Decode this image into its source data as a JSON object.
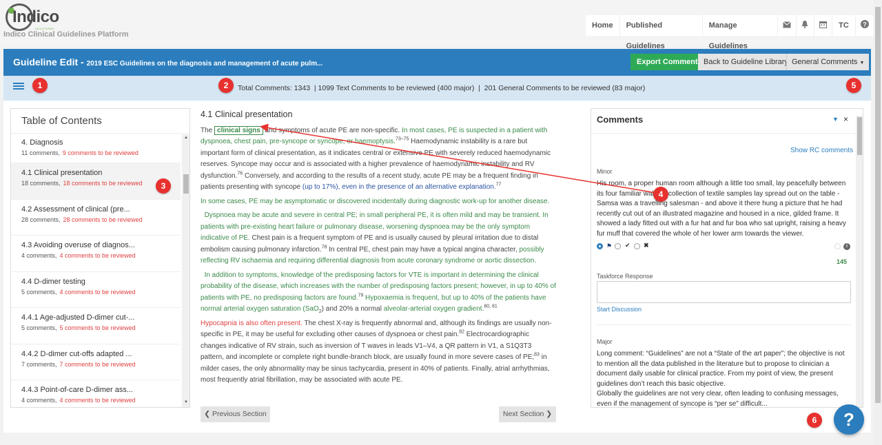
{
  "header": {
    "logo_text": "Indico",
    "logo_sub": "SOLUTIONS",
    "platform_name": "Indico Clinical Guidelines Platform",
    "nav": [
      "Home",
      "Published Guidelines",
      "Manage Guidelines"
    ],
    "icons": [
      "envelope-icon",
      "bell-icon",
      "calendar-icon",
      "user-initials",
      "help-circle-icon"
    ],
    "user_initials": "TC"
  },
  "titlebar": {
    "title": "Guideline Edit - ",
    "subtitle": "2019 ESC Guidelines on the diagnosis and management of acute pulm...",
    "export_label": "Export Comments",
    "back_label": "Back to Guideline Library",
    "general_label": "General Comments"
  },
  "statusbar": {
    "text": "Total Comments: 1343  | 1099 Text Comments to be reviewed (400 major)  |  201 General Comments to be reviewed (83 major)"
  },
  "badges": [
    "1",
    "2",
    "3",
    "4",
    "5",
    "6"
  ],
  "toc": {
    "heading": "Table of Contents",
    "items": [
      {
        "title": "4. Diagnosis",
        "comments": "11 comments,",
        "review": "9 comments to be reviewed"
      },
      {
        "title": "4.1 Clinical presentation",
        "comments": "18 comments,",
        "review": "18 comments to be reviewed"
      },
      {
        "title": "4.2 Assessment of clinical (pre...",
        "comments": "28 comments,",
        "review": "28 comments to be reviewed"
      },
      {
        "title": "4.3 Avoiding overuse of diagnos...",
        "comments": "4 comments,",
        "review": "4 comments to be reviewed"
      },
      {
        "title": "4.4 D-dimer testing",
        "comments": "5 comments,",
        "review": "4 comments to be reviewed"
      },
      {
        "title": "4.4.1 Age-adjusted D-dimer cut-...",
        "comments": "5 comments,",
        "review": "5 comments to be reviewed"
      },
      {
        "title": "4.4.2 D-dimer cut-offs adapted ...",
        "comments": "7 comments,",
        "review": "7 comments to be reviewed"
      },
      {
        "title": "4.4.3 Point-of-care D-dimer ass...",
        "comments": "4 comments,",
        "review": "4 comments to be reviewed"
      }
    ]
  },
  "content": {
    "heading": "4.1 Clinical presentation",
    "p1": {
      "a": "The ",
      "highlight": "clinical signs",
      "b": " and symptoms of acute PE are non-specific. ",
      "c": "In most cases, PE is suspected in a patient with dyspnoea, chest pain, pre-syncope or syncope, or haemoptysis.",
      "sup1": "73–75",
      "d": " Haemodynamic instability is a rare but important form of clinical presentation, as it indicates central or extensive PE with severely reduced haemodynamic reserves. Syncope may occur and is associated with a higher prevalence of haemodynamic instability and RV dysfunction.",
      "sup2": "76",
      "e": " Conversely, and according to the results of a recent study, acute PE may be a frequent finding in patients presenting with syncope ",
      "f": "(up to 17%), even in the presence of an alternative explanation.",
      "sup3": "77"
    },
    "p2": "In some cases, PE may be asymptomatic or discovered incidentally during diagnostic work-up for another disease.",
    "p3": {
      "a": "Dyspnoea may be acute and severe in central PE; in small peripheral PE, it is often mild and may be transient. In patients with pre-existing heart failure or pulmonary disease, worsening dyspnoea may be the only symptom indicative of PE.",
      "b": " Chest pain is a frequent symptom of PE and is usually caused by pleural irritation due to distal embolism causing pulmonary infarction.",
      "sup1": "78",
      "c": " In central PE, chest pain may have a typical angina character, ",
      "d": "possibly reflecting RV ischaemia and requiring differential diagnosis from acute coronary syndrome or aortic dissection."
    },
    "p4": {
      "a": "In addition to symptoms, knowledge of the predisposing factors for VTE is important in determining the clinical probability of the disease, which increases with the number of predisposing factors present; however, in up to 40% of patients with PE, no predisposing factors are found.",
      "sup1": "79",
      "b": " Hypoxaemia is frequent, but up to 40% of the patients have normal arterial oxygen saturation (SaO",
      "b_sub": "2",
      "b2": ") and 20% a normal ",
      "b3": "alveolar-arterial oxygen gradient.",
      "sup2": "80, 81",
      "c": "Hypocapnia is also often present.",
      "d": " The chest X-ray is frequently abnormal and, although its findings are usually non-specific in PE, it may be useful for excluding other causes of dyspnoea or chest pain.",
      "sup3": "82",
      "e": " Electrocardiographic changes indicative of RV strain, such as inversion of T waves in leads V1–V4, a QR pattern in V1, a S1Q3T3 pattern, and incomplete or complete right bundle-branch block, are usually found in more severe cases of PE;",
      "sup4": "83",
      "f": " in milder cases, the only abnormality may be sinus tachycardia, present in 40% of patients. Finally, atrial arrhythmias, most frequently atrial fibrillation, may be associated with acute PE."
    },
    "prev_label": "Previous Section",
    "next_label": "Next Section"
  },
  "comments": {
    "heading": "Comments",
    "show_rc": "Show RC comments",
    "c1": {
      "severity": "Minor",
      "text": "His room, a proper human room although a little too small, lay peacefully between its four familiar walls. A collection of textile samples lay spread out on the table - Samsa was a travelling salesman - and above it there hung a picture that he had recently cut out of an illustrated magazine and housed in a nice, gilded frame. It showed a lady fitted out with a fur hat and fur boa who sat upright, raising a heavy fur muff that covered the whole of her lower arm towards the viewer.",
      "count": "145"
    },
    "taskforce_label": "Taskforce Response",
    "start_discussion": "Start Discussion",
    "c2": {
      "severity": "Major",
      "text1": "Long comment: “Guidelines” are not a “State of the art paper”; the objective is not to mention all the data published in the literature but to propose to clinician a document daily usable for clinical practice. From my point of view, the present guidelines don’t reach this basic objective.",
      "text2": "Globally the guidelines are not very clear, often leading to confusing messages, even if the management of syncope is “per se” difficult..."
    }
  },
  "help_label": "?",
  "colors": {
    "primary": "#2b7dbd",
    "export": "#2eaa57",
    "badge": "#e8312f",
    "review_red": "#e04040",
    "green_text": "#3b8a4a"
  }
}
